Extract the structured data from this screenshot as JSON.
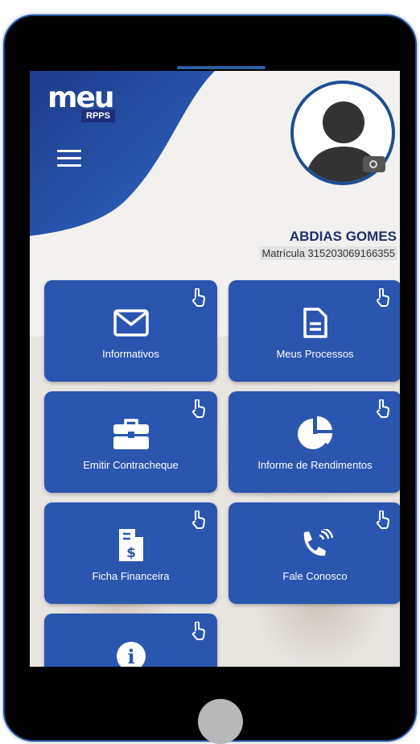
{
  "app": {
    "logo_text": "meu",
    "logo_badge": "RPPS"
  },
  "user": {
    "name": "ABDIAS GOMES",
    "registration": "Matrícula 315203069166355"
  },
  "colors": {
    "primary": "#2a56b0",
    "dark_blue": "#1c2e6d",
    "phone_frame": "#000000"
  },
  "menu": [
    {
      "label": "Informativos",
      "icon": "envelope-icon"
    },
    {
      "label": "Meus Processos",
      "icon": "document-icon"
    },
    {
      "label": "Emitir Contracheque",
      "icon": "briefcase-icon"
    },
    {
      "label": "Informe de Rendimentos",
      "icon": "pie-chart-icon"
    },
    {
      "label": "Ficha Financeira",
      "icon": "invoice-dollar-icon"
    },
    {
      "label": "Fale Conosco",
      "icon": "phone-icon"
    },
    {
      "label": "",
      "icon": "info-icon"
    }
  ]
}
